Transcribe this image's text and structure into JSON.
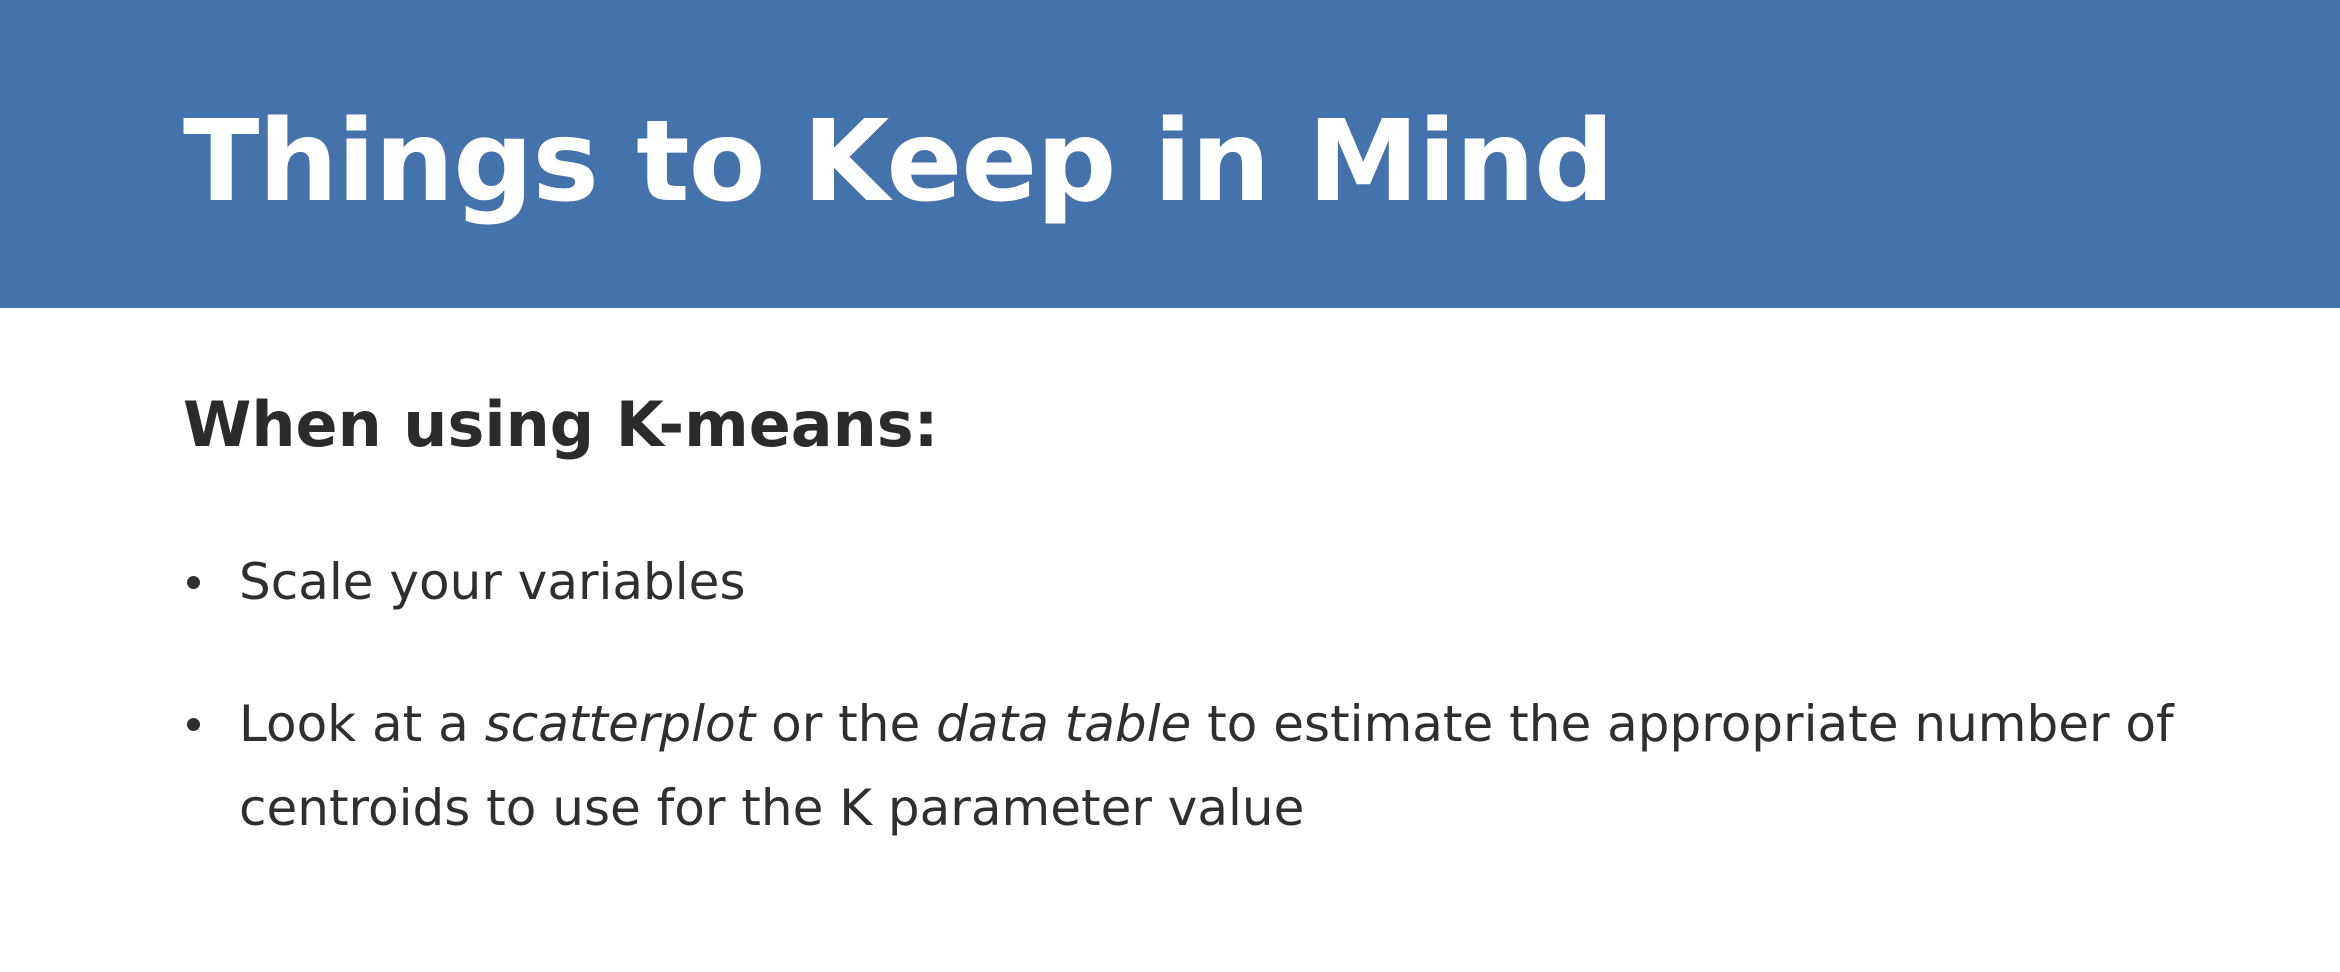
{
  "slide": {
    "title": "Things to Keep in Mind",
    "heading": "When using K-means:",
    "bullets": [
      {
        "text": "Scale your variables"
      },
      {
        "parts": [
          "Look at a ",
          "scatterplot",
          " or the ",
          "data table",
          " to estimate the appropriate number of centroids to use for the K parameter value"
        ]
      }
    ]
  },
  "colors": {
    "title_bar": "#4472ab",
    "title_text": "#ffffff",
    "body_text": "#2f2f2f",
    "background": "#ffffff"
  }
}
